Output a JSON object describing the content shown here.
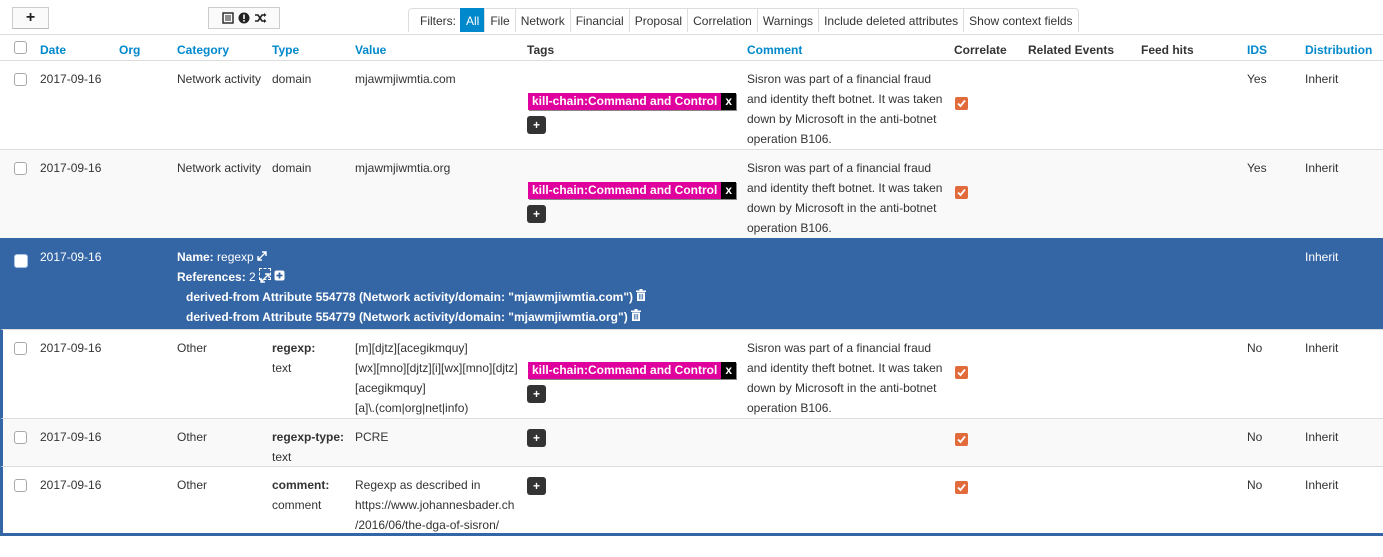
{
  "toolbar": {
    "add_label": "+",
    "filters_label": "Filters:",
    "filters": [
      "All",
      "File",
      "Network",
      "Financial",
      "Proposal",
      "Correlation",
      "Warnings",
      "Include deleted attributes",
      "Show context fields"
    ],
    "active_filter": "All"
  },
  "columns": {
    "date": "Date",
    "org": "Org",
    "category": "Category",
    "type": "Type",
    "value": "Value",
    "tags": "Tags",
    "comment": "Comment",
    "correlate": "Correlate",
    "related": "Related Events",
    "feed": "Feed hits",
    "ids": "IDS",
    "distribution": "Distribution"
  },
  "rows": [
    {
      "date": "2017-09-16",
      "category": "Network activity",
      "type": "domain",
      "value": "mjawmjiwmtia.com",
      "tag": "kill-chain:Command and Control",
      "tag_remove": "x",
      "tag_add": "+",
      "comment": [
        "Sisron was part of a financial fraud",
        "and identity theft botnet. It was taken",
        "down by Microsoft in the anti-botnet",
        "operation B106."
      ],
      "ids": "Yes",
      "distribution": "Inherit"
    },
    {
      "date": "2017-09-16",
      "category": "Network activity",
      "type": "domain",
      "value": "mjawmjiwmtia.org",
      "tag": "kill-chain:Command and Control",
      "tag_remove": "x",
      "tag_add": "+",
      "comment": [
        "Sisron was part of a financial fraud",
        "and identity theft botnet. It was taken",
        "down by Microsoft in the anti-botnet",
        "operation B106."
      ],
      "ids": "Yes",
      "distribution": "Inherit"
    }
  ],
  "object": {
    "date": "2017-09-16",
    "name_label": "Name:",
    "name": "regexp",
    "references_label": "References:",
    "references_count": "2",
    "refs": [
      "derived-from Attribute 554778 (Network activity/domain: \"mjawmjiwmtia.com\")",
      "derived-from Attribute 554779 (Network activity/domain: \"mjawmjiwmtia.org\")"
    ],
    "distribution": "Inherit",
    "attributes": [
      {
        "date": "2017-09-16",
        "category": "Other",
        "relation": "regexp:",
        "type": "text",
        "value": [
          "[m][djtz][acegikmquy]",
          "[wx][mno][djtz][i][wx][mno][djtz]",
          "[acegikmquy]",
          "[a]\\.(com|org|net|info)"
        ],
        "tag": "kill-chain:Command and Control",
        "tag_remove": "x",
        "tag_add": "+",
        "comment": [
          "Sisron was part of a financial fraud",
          "and identity theft botnet. It was taken",
          "down by Microsoft in the anti-botnet",
          "operation B106."
        ],
        "ids": "No",
        "distribution": "Inherit"
      },
      {
        "date": "2017-09-16",
        "category": "Other",
        "relation": "regexp-type:",
        "type": "text",
        "value": [
          "PCRE"
        ],
        "tag_add": "+",
        "ids": "No",
        "distribution": "Inherit"
      },
      {
        "date": "2017-09-16",
        "category": "Other",
        "relation": "comment:",
        "type": "comment",
        "value": [
          "Regexp as described in",
          "https://www.johannesbader.ch",
          "/2016/06/the-dga-of-sisron/"
        ],
        "tag_add": "+",
        "ids": "No",
        "distribution": "Inherit"
      }
    ]
  },
  "colors": {
    "accent": "#0088cc",
    "object_row": "#3465a4",
    "tag": "#e0009d",
    "checkbox": "#e26b3c"
  }
}
